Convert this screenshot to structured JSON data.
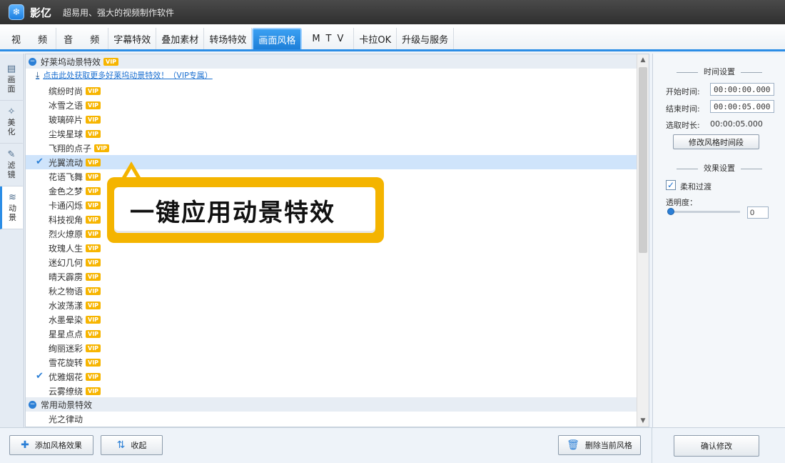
{
  "app": {
    "name": "影亿",
    "slogan": "超易用、强大的视频制作软件"
  },
  "tabs": [
    {
      "label": "视 频",
      "active": false
    },
    {
      "label": "音 频",
      "active": false
    },
    {
      "label": "字幕特效",
      "active": false
    },
    {
      "label": "叠加素材",
      "active": false
    },
    {
      "label": "转场特效",
      "active": false
    },
    {
      "label": "画面风格",
      "active": true
    },
    {
      "label": "MTV",
      "active": false
    },
    {
      "label": "卡拉OK",
      "active": false
    },
    {
      "label": "升级与服务",
      "active": false
    }
  ],
  "sidetabs": [
    {
      "label1": "画",
      "label2": "面",
      "icon": "film-icon"
    },
    {
      "label1": "美",
      "label2": "化",
      "icon": "magic-wand-icon"
    },
    {
      "label1": "滤",
      "label2": "镜",
      "icon": "filter-brush-icon"
    },
    {
      "label1": "动",
      "label2": "景",
      "icon": "waves-icon"
    }
  ],
  "list": {
    "group1_title": "好莱坞动景特效",
    "vip_badge": "VIP",
    "promo_link": "点击此处获取更多好莱坞动景特效！（VIP专属）",
    "items": [
      {
        "label": "缤纷时尚",
        "checked": false,
        "selected": false
      },
      {
        "label": "冰雪之语",
        "checked": false,
        "selected": false
      },
      {
        "label": "玻璃碎片",
        "checked": false,
        "selected": false
      },
      {
        "label": "尘埃星球",
        "checked": false,
        "selected": false
      },
      {
        "label": "飞翔的点子",
        "checked": false,
        "selected": false
      },
      {
        "label": "光翼流动",
        "checked": true,
        "selected": true
      },
      {
        "label": "花语飞舞",
        "checked": false,
        "selected": false
      },
      {
        "label": "金色之梦",
        "checked": false,
        "selected": false
      },
      {
        "label": "卡通闪烁",
        "checked": false,
        "selected": false
      },
      {
        "label": "科技视角",
        "checked": false,
        "selected": false
      },
      {
        "label": "烈火燎原",
        "checked": false,
        "selected": false
      },
      {
        "label": "玫瑰人生",
        "checked": false,
        "selected": false
      },
      {
        "label": "迷幻几何",
        "checked": false,
        "selected": false
      },
      {
        "label": "晴天霹雳",
        "checked": false,
        "selected": false
      },
      {
        "label": "秋之物语",
        "checked": false,
        "selected": false
      },
      {
        "label": "水波荡漾",
        "checked": false,
        "selected": false
      },
      {
        "label": "水墨晕染",
        "checked": false,
        "selected": false
      },
      {
        "label": "星星点点",
        "checked": false,
        "selected": false
      },
      {
        "label": "绚丽迷彩",
        "checked": false,
        "selected": false
      },
      {
        "label": "雪花旋转",
        "checked": false,
        "selected": false
      },
      {
        "label": "优雅烟花",
        "checked": true,
        "selected": false
      },
      {
        "label": "云雾缭绕",
        "checked": false,
        "selected": false
      }
    ],
    "group2_title": "常用动景特效",
    "group2_items": [
      {
        "label": "光之律动"
      }
    ]
  },
  "callout": {
    "text": "一键应用动景特效"
  },
  "right": {
    "time_title": "时间设置",
    "start_label": "开始时间:",
    "start_value": "00:00:00.000",
    "end_label": "结束时间:",
    "end_value": "00:00:05.000",
    "duration_label": "选取时长:",
    "duration_value": "00:00:05.000",
    "modify_time_button": "修改风格时间段",
    "effect_title": "效果设置",
    "smooth_label": "柔和过渡",
    "smooth_checked": true,
    "opacity_label": "透明度：",
    "opacity_value": "0"
  },
  "bottom": {
    "add_button": "添加风格效果",
    "collapse_button": "收起",
    "delete_button": "删除当前风格",
    "confirm_button": "确认修改"
  },
  "colors": {
    "accent": "#2b8de6",
    "vip": "#f7b500",
    "callout": "#f4b400",
    "selected_row": "#cfe4fb"
  }
}
